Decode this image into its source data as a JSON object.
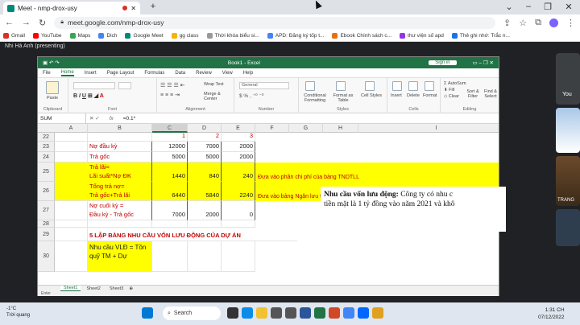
{
  "browser": {
    "tab_title": "Meet - nmp-drox-usy",
    "url": "meet.google.com/nmp-drox-usy",
    "bookmarks": [
      {
        "label": "Gmail",
        "color": "#d93025"
      },
      {
        "label": "YouTube",
        "color": "#ff0000"
      },
      {
        "label": "Maps",
        "color": "#34a853"
      },
      {
        "label": "Dich",
        "color": "#4285f4"
      },
      {
        "label": "Google Meet",
        "color": "#00897b"
      },
      {
        "label": "gg class",
        "color": "#f4b400"
      },
      {
        "label": "Thời khóa biểu si...",
        "color": "#999999"
      },
      {
        "label": "APD: Đăng ký tốp t...",
        "color": "#4285f4"
      },
      {
        "label": "Ebook Chính sách c...",
        "color": "#e8710a"
      },
      {
        "label": "thư viện số apd",
        "color": "#9334e6"
      },
      {
        "label": "Thẻ ghi nhớ: Trắc n...",
        "color": "#1a73e8"
      }
    ]
  },
  "meet": {
    "speaker_name": "Nhi Hà Anh (presenting)",
    "side_label_you": "You",
    "side_label_trang": "TRANG"
  },
  "excel": {
    "title": "Book1 - Excel",
    "signin": "Sign in",
    "menu": [
      "File",
      "Home",
      "Insert",
      "Page Layout",
      "Formulas",
      "Data",
      "Review",
      "View",
      "Help"
    ],
    "ribbon_groups": [
      "Clipboard",
      "Font",
      "Alignment",
      "Number",
      "Styles",
      "Cells",
      "Editing"
    ],
    "ribbon_buttons": {
      "paste": "Paste",
      "wrap": "Wrap Text",
      "merge": "Merge & Center",
      "general": "General",
      "conditional": "Conditional Formatting",
      "format_table": "Format as Table",
      "cell_styles": "Cell Styles",
      "insert": "Insert",
      "delete": "Delete",
      "format": "Format",
      "autosum": "AutoSum",
      "fill": "Fill",
      "clear": "Clear",
      "sort": "Sort & Filter",
      "find": "Find & Select"
    },
    "name_box": "SUM",
    "formula": "=0.1*",
    "columns": [
      "A",
      "B",
      "C",
      "D",
      "E",
      "F",
      "G",
      "H",
      "I"
    ],
    "rows": [
      {
        "num": "22",
        "b": "",
        "c": "1",
        "d": "2",
        "e": "3",
        "note": "",
        "yellow": false,
        "red_nums": true
      },
      {
        "num": "23",
        "b": "Nợ đầu kỳ",
        "c": "12000",
        "d": "7000",
        "e": "2000",
        "note": "",
        "yellow": false
      },
      {
        "num": "24",
        "b": "Trả gốc",
        "c": "5000",
        "d": "5000",
        "e": "2000",
        "note": "",
        "yellow": false
      },
      {
        "num": "25",
        "b": "Trả lãi=\nLãi suất*Nợ ĐK",
        "c": "1440",
        "d": "840",
        "e": "240",
        "note": "Đưa vào phần chi phí của bảng TNDTLL",
        "yellow": true
      },
      {
        "num": "26",
        "b": "Tổng trả nợ=\nTrả gốc+Trả lãi",
        "c": "6440",
        "d": "5840",
        "e": "2240",
        "note": "Đưa vào bảng Ngân lưu theo quan điểm EPV",
        "yellow": true
      },
      {
        "num": "27",
        "b": "Nợ cuối kỳ =\nĐầu kỳ - Trả gốc",
        "c": "7000",
        "d": "2000",
        "e": "0",
        "note": "",
        "yellow": false
      },
      {
        "num": "28",
        "b": "",
        "c": "",
        "d": "",
        "e": "",
        "note": "",
        "yellow": false
      },
      {
        "num": "29",
        "b": "5  LẬP BẢNG NHU CẦU VỐN LƯU ĐỘNG CỦA DỰ ÁN",
        "c": "",
        "d": "",
        "e": "",
        "note": "",
        "yellow": false
      },
      {
        "num": "30",
        "b": "Nhu cầu VLĐ = Tồn\nquỹ TM + Dự",
        "c": "",
        "d": "",
        "e": "",
        "note": "",
        "yellow": true
      }
    ],
    "doc_text_bold": "Nhu cầu vốn lưu động:",
    "doc_text_1": " Công ty có nhu c",
    "doc_text_2": "tiền mặt là 1 tỷ đồng vào năm 2021 và khô",
    "sheets": [
      "Sheet1",
      "Sheet2",
      "Sheet3"
    ],
    "status": "Enter"
  },
  "taskbar": {
    "temp": "-1°C",
    "weather": "Trời quang",
    "search": "Search",
    "time": "1:31 CH",
    "date": "07/12/2022",
    "icons": [
      {
        "name": "windows-icon",
        "color": "#0078d4"
      },
      {
        "name": "task-view-icon",
        "color": "#333333"
      },
      {
        "name": "edge-icon",
        "color": "#0c8ce9"
      },
      {
        "name": "file-explorer-icon",
        "color": "#f2c230"
      },
      {
        "name": "store-icon",
        "color": "#555555"
      },
      {
        "name": "camera-icon",
        "color": "#555555"
      },
      {
        "name": "word-icon",
        "color": "#2b579a"
      },
      {
        "name": "excel-icon",
        "color": "#217346"
      },
      {
        "name": "powerpoint-icon",
        "color": "#d24726"
      },
      {
        "name": "chrome-icon",
        "color": "#4285f4"
      },
      {
        "name": "zalo-icon",
        "color": "#0068ff"
      },
      {
        "name": "files-icon",
        "color": "#e0a020"
      }
    ]
  }
}
